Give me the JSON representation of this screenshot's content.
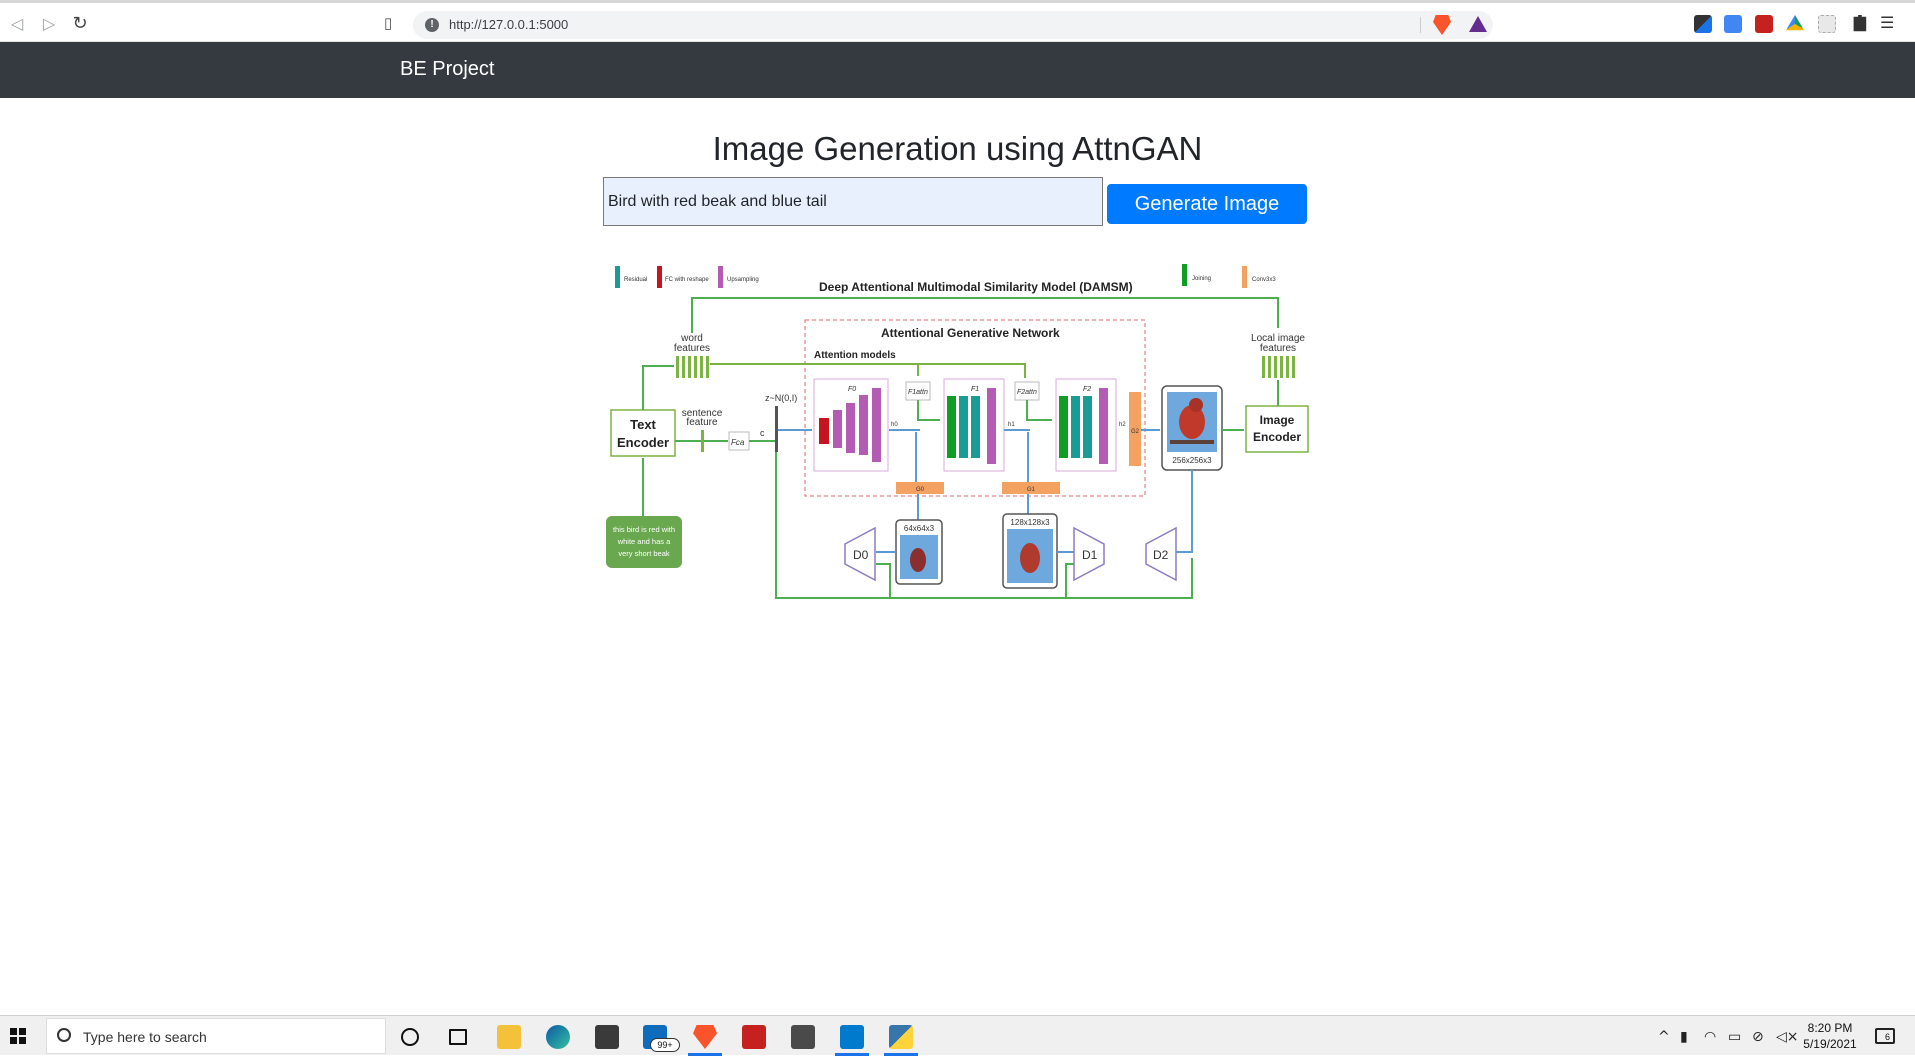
{
  "browser": {
    "url": "http://127.0.0.1:5000"
  },
  "navbar": {
    "brand": "BE Project"
  },
  "main": {
    "title": "Image Generation using AttnGAN",
    "prompt_value": "Bird with red beak and blue tail",
    "button_label": "Generate Image"
  },
  "diagram": {
    "legend": [
      "Residual",
      "FC with reshape",
      "Upsampling",
      "Joining",
      "Conv3x3"
    ],
    "damsm_title": "Deep Attentional Multimodal Similarity Model (DAMSM)",
    "agn_title": "Attentional Generative Network",
    "attention_models": "Attention models",
    "word_features": [
      "word",
      "features"
    ],
    "sentence_feature": [
      "sentence",
      "feature"
    ],
    "local_features": [
      "Local image",
      "features"
    ],
    "text_encoder": [
      "Text",
      "Encoder"
    ],
    "image_encoder": [
      "Image",
      "Encoder"
    ],
    "noise": "z~N(0,I)",
    "caption_box": [
      "this bird is red with",
      "white and has a",
      "very short beak"
    ],
    "size_64": "64x64x3",
    "size_128": "128x128x3",
    "size_256": "256x256x3",
    "d0": "D0",
    "d1": "D1",
    "d2": "D2",
    "g0": "G0",
    "g1": "G1",
    "g2": "G2",
    "f0": "F0",
    "f1": "F1",
    "f2": "F2",
    "c": "c",
    "h0": "h0",
    "h1": "h1",
    "h2": "h2",
    "fca": "Fca",
    "f1attn": "F1attn",
    "f2attn": "F2attn",
    "colors": {
      "residual": "#1a9c96",
      "fc": "#c8141e",
      "upsampling": "#b45bb4",
      "joining": "#0f9d24",
      "conv": "#f4a261",
      "line": "#4caf50",
      "blue_line": "#5b9bd5"
    }
  },
  "taskbar": {
    "search_placeholder": "Type here to search",
    "mail_badge": "99+",
    "time": "8:20 PM",
    "date": "5/19/2021",
    "notification_count": "6"
  }
}
